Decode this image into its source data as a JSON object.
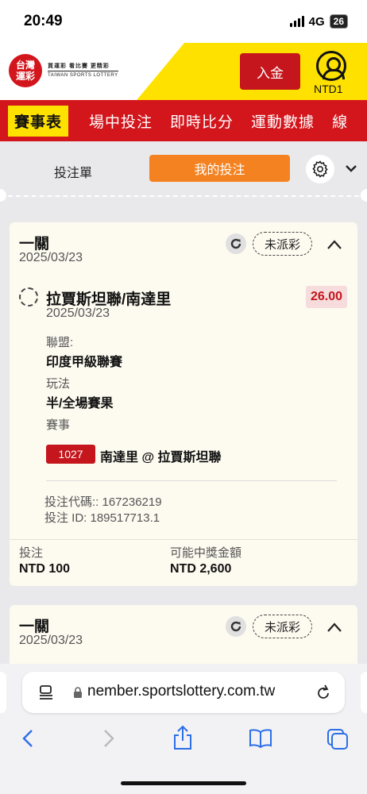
{
  "status": {
    "time": "20:49",
    "network": "4G",
    "battery": "26"
  },
  "header": {
    "logo_badge": "台灣\n運彩",
    "logo_cn": "買運彩 看比賽 更精彩",
    "logo_en": "TAIWAN SPORTS LOTTERY",
    "deposit_label": "入金",
    "balance": "NTD1"
  },
  "nav": {
    "items": [
      "賽事表",
      "場中投注",
      "即時比分",
      "運動數據",
      "線"
    ]
  },
  "tabs": {
    "bet_slip": "投注單",
    "my_bets": "我的投注"
  },
  "bets": [
    {
      "type": "一關",
      "date": "2025/03/23",
      "status": "未派彩",
      "match": "拉賈斯坦聯/南達里",
      "match_date": "2025/03/23",
      "odds": "26.00",
      "league_label": "聯盟:",
      "league": "印度甲級聯賽",
      "market_label": "玩法",
      "market": "半/全場賽果",
      "event_label": "賽事",
      "event_id": "1027",
      "event_name": "南達里 @ 拉賈斯坦聯",
      "bet_code": "投注代碼:: 167236219",
      "bet_id": "投注 ID: 189517713.1",
      "stake_label": "投注",
      "stake": "NTD 100",
      "payout_label": "可能中獎金額",
      "payout": "NTD 2,600"
    },
    {
      "type": "一關",
      "date": "2025/03/23",
      "status": "未派彩"
    }
  ],
  "browser": {
    "url": "member.sportslottery.com.tw",
    "url_visible": "nember.sportslottery.com.tw"
  },
  "colors": {
    "brand_red": "#d3151c",
    "brand_yellow": "#ffe100",
    "accent_orange": "#f58220"
  }
}
